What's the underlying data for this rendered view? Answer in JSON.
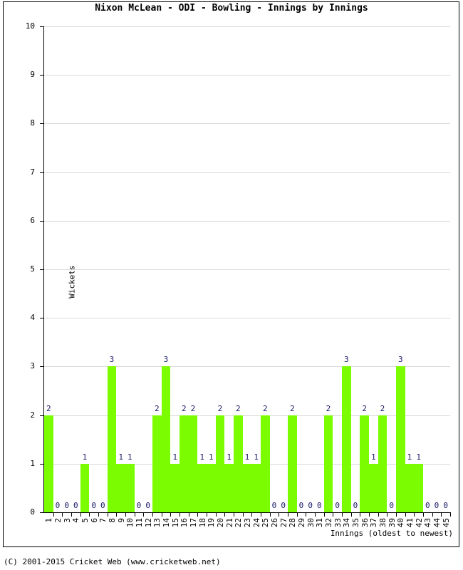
{
  "chart_data": {
    "type": "bar",
    "title": "Nixon McLean - ODI - Bowling - Innings by Innings",
    "xlabel": "Innings (oldest to newest)",
    "ylabel": "Wickets",
    "ylim": [
      0,
      10
    ],
    "yticks": [
      0,
      1,
      2,
      3,
      4,
      5,
      6,
      7,
      8,
      9,
      10
    ],
    "grid": true,
    "legend": null,
    "bar_color": "#7cfc00",
    "value_label_color": "#171766",
    "categories": [
      1,
      2,
      3,
      4,
      5,
      6,
      7,
      8,
      9,
      10,
      11,
      12,
      13,
      14,
      15,
      16,
      17,
      18,
      19,
      20,
      21,
      22,
      23,
      24,
      25,
      26,
      27,
      28,
      29,
      30,
      31,
      32,
      33,
      34,
      35,
      36,
      37,
      38,
      39,
      40,
      41,
      42,
      43,
      44,
      45
    ],
    "values": [
      2,
      0,
      0,
      0,
      1,
      0,
      0,
      3,
      1,
      1,
      0,
      0,
      2,
      3,
      1,
      2,
      2,
      1,
      1,
      2,
      1,
      2,
      1,
      1,
      2,
      0,
      0,
      2,
      0,
      0,
      0,
      2,
      0,
      3,
      0,
      2,
      1,
      2,
      0,
      3,
      1,
      1,
      0,
      0,
      0
    ]
  },
  "footer": {
    "copyright": "(C) 2001-2015 Cricket Web (www.cricketweb.net)"
  }
}
